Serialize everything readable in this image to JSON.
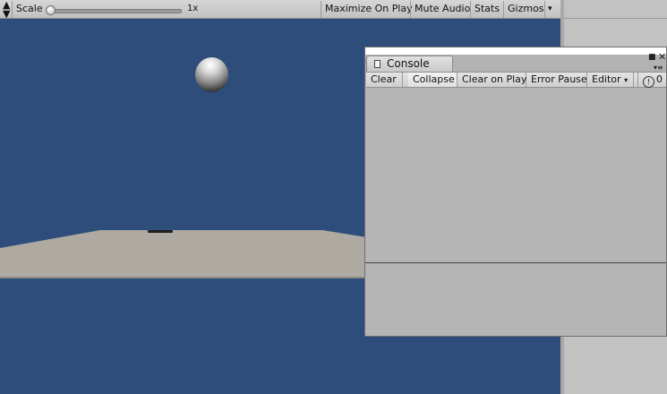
{
  "game_view": {
    "toolbar": {
      "scale_label": "Scale",
      "scale_value": "1x",
      "scale_slider_fraction": 0.0,
      "maximize_label": "Maximize On Play",
      "mute_label": "Mute Audio",
      "stats_label": "Stats",
      "gizmos_label": "Gizmos",
      "gizmos_arrow": "▾"
    },
    "colors": {
      "sky": "#2f4d7b",
      "ground": "#aeaaa2"
    }
  },
  "console": {
    "tab_label": "Console",
    "toolbar": {
      "clear_label": "Clear",
      "collapse_label": "Collapse",
      "clear_on_play_label": "Clear on Play",
      "error_pause_label": "Error Pause",
      "editor_label": "Editor",
      "editor_arrow": "▾",
      "warning_count": "0"
    }
  }
}
